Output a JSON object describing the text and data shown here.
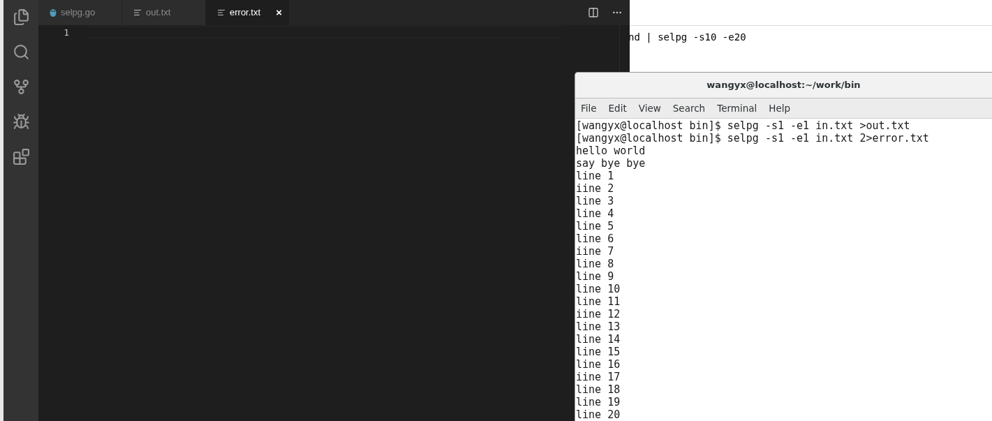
{
  "editor": {
    "tabs": [
      {
        "label": "selpg.go",
        "kind": "go",
        "selected": false
      },
      {
        "label": "out.txt",
        "kind": "text",
        "selected": false
      },
      {
        "label": "error.txt",
        "kind": "text",
        "selected": true,
        "close": "×"
      }
    ],
    "line_numbers": [
      "1"
    ]
  },
  "background_window": {
    "text": "nd | selpg -s10 -e20"
  },
  "terminal": {
    "title": "wangyx@localhost:~/work/bin",
    "menu": [
      "File",
      "Edit",
      "View",
      "Search",
      "Terminal",
      "Help"
    ],
    "lines": [
      "[wangyx@localhost bin]$ selpg -s1 -e1 in.txt >out.txt",
      "[wangyx@localhost bin]$ selpg -s1 -e1 in.txt 2>error.txt",
      "hello world",
      "say bye bye",
      "line 1",
      "iine 2",
      "line 3",
      "line 4",
      "line 5",
      "line 6",
      "iine 7",
      "line 8",
      "line 9",
      "line 10",
      "line 11",
      "iine 12",
      "line 13",
      "line 14",
      "line 15",
      "line 16",
      "iine 17",
      "line 18",
      "line 19",
      "line 20"
    ]
  }
}
